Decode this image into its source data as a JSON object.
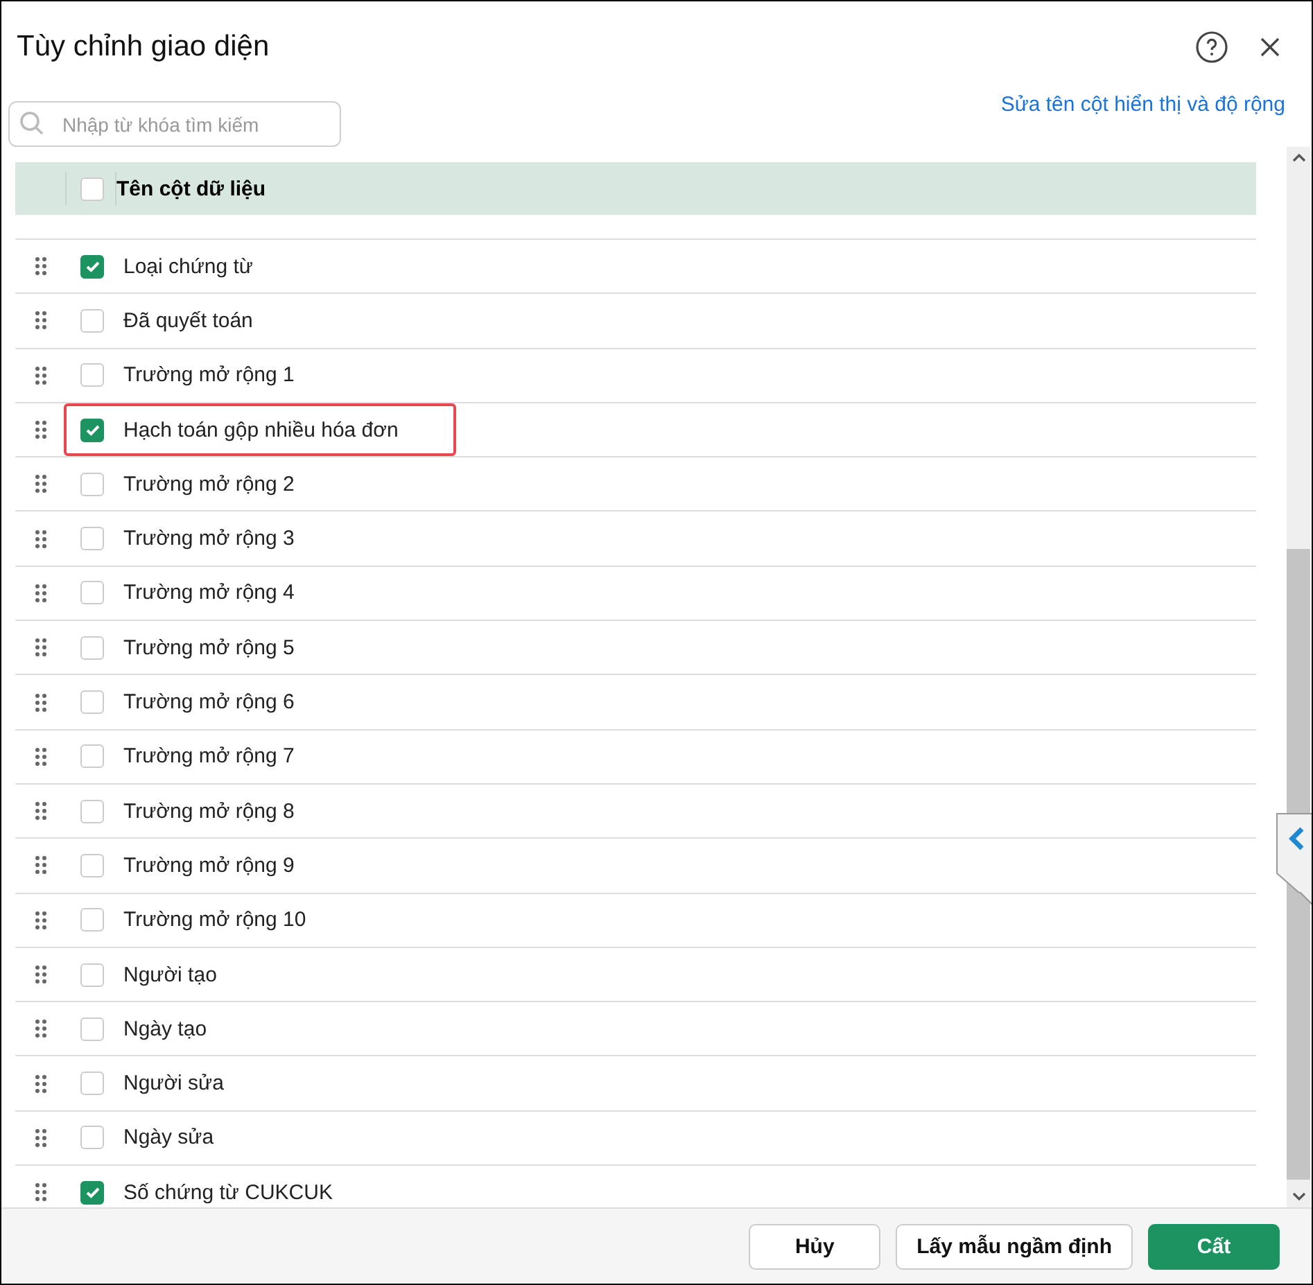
{
  "dialog": {
    "title": "Tùy chỉnh giao diện"
  },
  "search": {
    "placeholder": "Nhập từ khóa tìm kiếm"
  },
  "link": "Sửa tên cột hiển thị và độ rộng",
  "table": {
    "header": {
      "label": "Tên cột dữ liệu",
      "checked": false
    },
    "rows": [
      {
        "label": "Loại chứng từ",
        "checked": true,
        "highlighted": false
      },
      {
        "label": "Đã quyết toán",
        "checked": false,
        "highlighted": false
      },
      {
        "label": "Trường mở rộng 1",
        "checked": false,
        "highlighted": false
      },
      {
        "label": "Hạch toán gộp nhiều hóa đơn",
        "checked": true,
        "highlighted": true
      },
      {
        "label": "Trường mở rộng 2",
        "checked": false,
        "highlighted": false
      },
      {
        "label": "Trường mở rộng 3",
        "checked": false,
        "highlighted": false
      },
      {
        "label": "Trường mở rộng 4",
        "checked": false,
        "highlighted": false
      },
      {
        "label": "Trường mở rộng 5",
        "checked": false,
        "highlighted": false
      },
      {
        "label": "Trường mở rộng 6",
        "checked": false,
        "highlighted": false
      },
      {
        "label": "Trường mở rộng 7",
        "checked": false,
        "highlighted": false
      },
      {
        "label": "Trường mở rộng 8",
        "checked": false,
        "highlighted": false
      },
      {
        "label": "Trường mở rộng 9",
        "checked": false,
        "highlighted": false
      },
      {
        "label": "Trường mở rộng 10",
        "checked": false,
        "highlighted": false
      },
      {
        "label": "Người tạo",
        "checked": false,
        "highlighted": false
      },
      {
        "label": "Ngày tạo",
        "checked": false,
        "highlighted": false
      },
      {
        "label": "Người sửa",
        "checked": false,
        "highlighted": false
      },
      {
        "label": "Ngày sửa",
        "checked": false,
        "highlighted": false
      },
      {
        "label": "Số chứng từ CUKCUK",
        "checked": true,
        "highlighted": false
      }
    ]
  },
  "buttons": [
    {
      "label": "Hủy",
      "kind": "secondary"
    },
    {
      "label": "Lấy mẫu ngầm định",
      "kind": "secondary"
    },
    {
      "label": "Cất",
      "kind": "primary"
    }
  ]
}
